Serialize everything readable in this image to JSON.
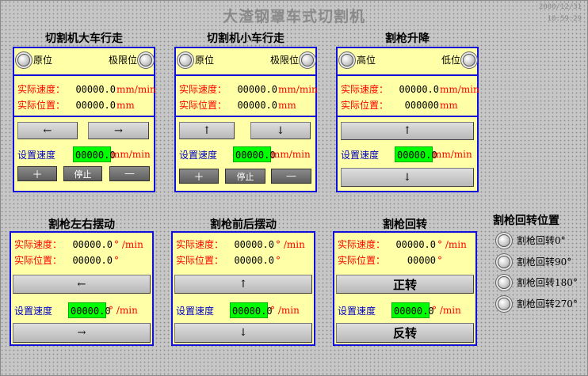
{
  "header": {
    "title": "大渣钢罩车式切割机",
    "date": "2000/12/31",
    "time": "10:59:29"
  },
  "common": {
    "actual_speed": "实际速度：",
    "actual_pos": "实际位置：",
    "set_speed": "设置速度",
    "plus": "＋",
    "stop": "停止",
    "minus": "—",
    "speed_unit_mm": "mm/min",
    "pos_unit_mm": "mm",
    "speed_unit_deg": "° /min",
    "pos_unit_deg": "°",
    "left_arrow": "←",
    "right_arrow": "→",
    "up_arrow": "↑",
    "down_arrow": "↓"
  },
  "panel1": {
    "title": "切割机大车行走",
    "home": "原位",
    "limit": "极限位",
    "speed": "00000.0",
    "position": "00000.0",
    "set_value": "00000.0"
  },
  "panel2": {
    "title": "切割机小车行走",
    "home": "原位",
    "limit": "极限位",
    "speed": "00000.0",
    "position": "00000.0",
    "set_value": "00000.0"
  },
  "panel3": {
    "title": "割枪升降",
    "high": "高位",
    "low": "低位",
    "speed": "00000.0",
    "position": "000000",
    "set_value": "00000.0"
  },
  "panel4": {
    "title": "割枪左右摆动",
    "speed": "00000.0",
    "position": "00000.0",
    "set_value": "00000.0"
  },
  "panel5": {
    "title": "割枪前后摆动",
    "speed": "00000.0",
    "position": "00000.0",
    "set_value": "00000.0"
  },
  "panel6": {
    "title": "割枪回转",
    "speed": "00000.0",
    "position": "00000",
    "set_value": "00000.0",
    "forward": "正转",
    "reverse": "反转"
  },
  "rotation_pos": {
    "title": "割枪回转位置",
    "items": [
      "割枪回转0°",
      "割枪回转90°",
      "割枪回转180°",
      "割枪回转270°"
    ]
  },
  "colors": {
    "panel_bg": "#ffffa8",
    "panel_border": "#1010d8",
    "value_box": "#00ff00",
    "label_red": "#ff0000"
  }
}
